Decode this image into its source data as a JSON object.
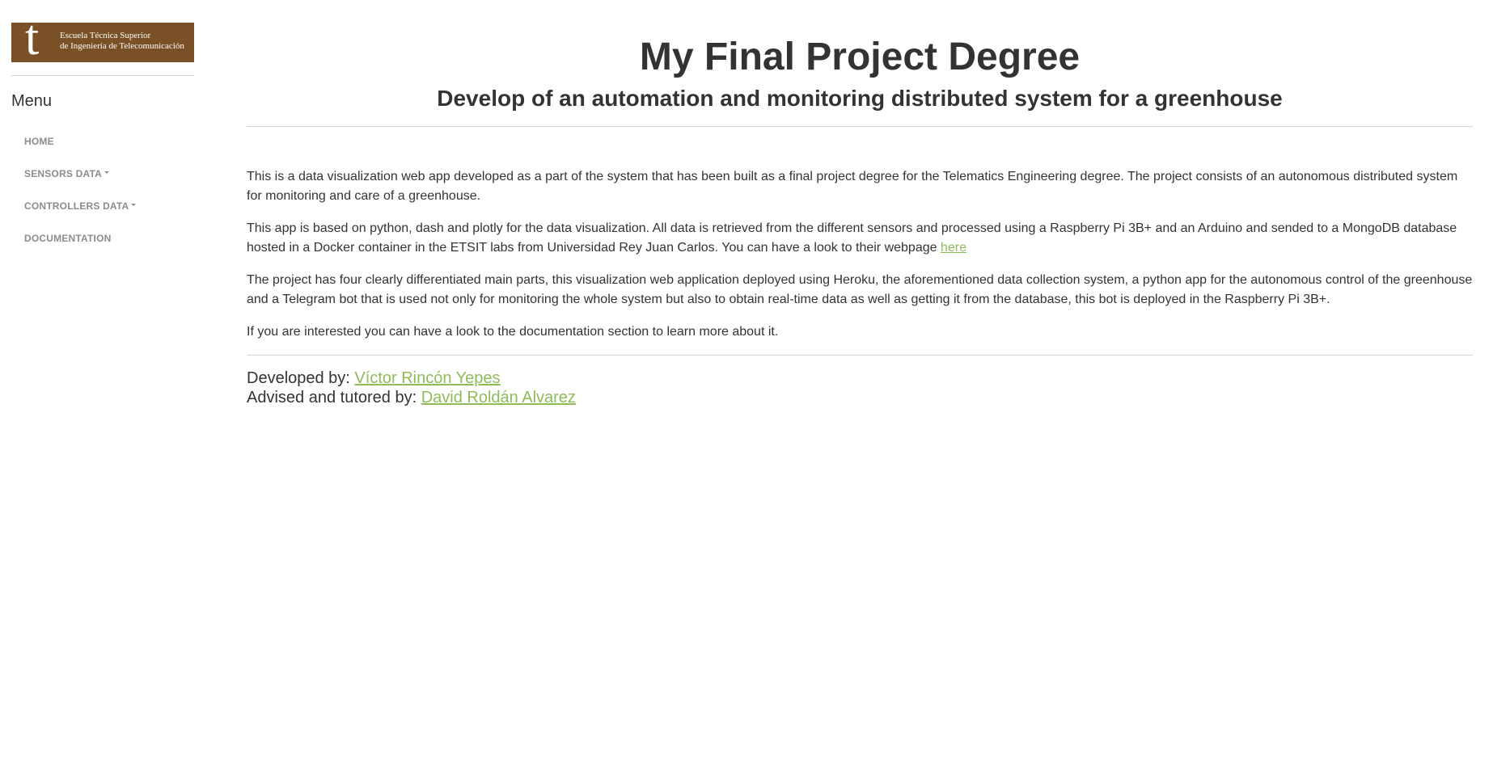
{
  "sidebar": {
    "logo": {
      "letter": "t",
      "line1": "Escuela Técnica Superior",
      "line2": "de Ingeniería de Telecomunicación"
    },
    "menu_title": "Menu",
    "items": [
      {
        "label": "HOME",
        "dropdown": false
      },
      {
        "label": "SENSORS DATA",
        "dropdown": true
      },
      {
        "label": "CONTROLLERS DATA",
        "dropdown": true
      },
      {
        "label": "DOCUMENTATION",
        "dropdown": false
      }
    ]
  },
  "header": {
    "title": "My Final Project Degree",
    "subtitle": "Develop of an automation and monitoring distributed system for a greenhouse"
  },
  "content": {
    "p1": "This is a data visualization web app developed as a part of the system that has been built as a final project degree for the Telematics Engineering degree. The project consists of an autonomous distributed system for monitoring and care of a greenhouse.",
    "p2_text": "This app is based on python, dash and plotly for the data visualization. All data is retrieved from the different sensors and processed using a Raspberry Pi 3B+ and an Arduino and sended to a MongoDB database hosted in a Docker container in the ETSIT labs from Universidad Rey Juan Carlos. You can have a look to their webpage ",
    "p2_link": "here",
    "p3": "The project has four clearly differentiated main parts, this visualization web application deployed using Heroku, the aforementioned data collection system, a python app for the autonomous control of the greenhouse and a Telegram bot that is used not only for monitoring the whole system but also to obtain real-time data as well as getting it from the database, this bot is deployed in the Raspberry Pi 3B+.",
    "p4": "If you are interested you can have a look to the documentation section to learn more about it."
  },
  "credits": {
    "developed_label": "Developed by: ",
    "developer": "Víctor Rincón Yepes",
    "advised_label": "Advised and tutored by: ",
    "advisor": "David Roldán Alvarez"
  },
  "colors": {
    "logo_bg": "#7a5126",
    "link": "#8fbc5a",
    "nav_text": "#8c8c8c",
    "text": "#333333"
  }
}
